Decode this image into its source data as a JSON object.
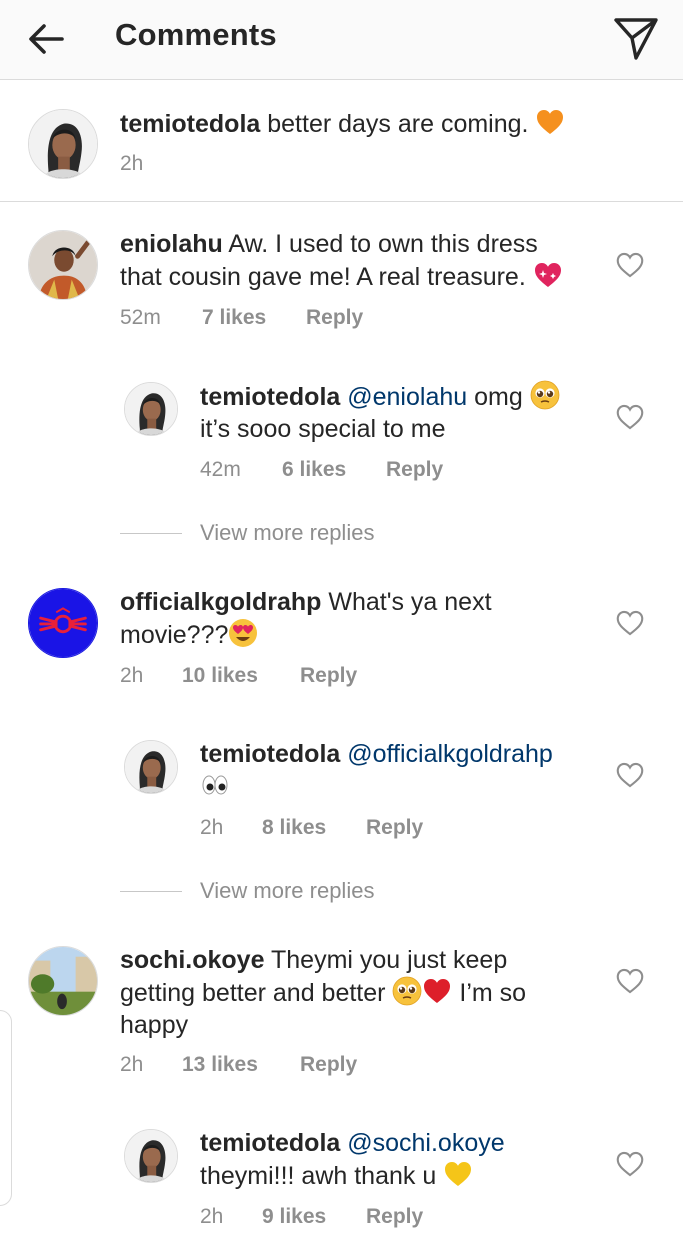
{
  "header": {
    "title": "Comments",
    "back_icon": "arrow-left-icon",
    "send_icon": "paper-plane-icon"
  },
  "caption": {
    "username": "temiotedola",
    "text": "better days are coming.",
    "emoji": "orange-heart",
    "time": "2h"
  },
  "comments": [
    {
      "username": "eniolahu",
      "text_line1": "Aw. I used to own this dress",
      "text_line2": "that cousin gave me! A real treasure.",
      "emoji": "sparkling-heart",
      "time": "52m",
      "likes": "7 likes",
      "reply": "Reply",
      "replies": [
        {
          "username": "temiotedola",
          "mention": "@eniolahu",
          "text_line1": "omg",
          "emoji": "pleading-face",
          "text_line2": "it’s sooo special to me",
          "time": "42m",
          "likes": "6 likes",
          "reply": "Reply"
        }
      ],
      "view_more": "View more replies"
    },
    {
      "username": "officialkgoldrahp",
      "text_line1": "What's ya next",
      "text_line2": "movie???",
      "emoji": "heart-eyes",
      "time": "2h",
      "likes": "10 likes",
      "reply": "Reply",
      "replies": [
        {
          "username": "temiotedola",
          "mention": "@officialkgoldrahp",
          "emoji": "eyes",
          "time": "2h",
          "likes": "8 likes",
          "reply": "Reply"
        }
      ],
      "view_more": "View more replies"
    },
    {
      "username": "sochi.okoye",
      "text_line1": "Theymi you just keep",
      "text_line2a": "getting better and better",
      "text_line2b": "I’m so",
      "text_line3": "happy",
      "emojis": [
        "pleading-face",
        "red-heart"
      ],
      "time": "2h",
      "likes": "13 likes",
      "reply": "Reply",
      "replies": [
        {
          "username": "temiotedola",
          "mention": "@sochi.okoye",
          "text_line2": "theymi!!! awh thank u",
          "emoji": "yellow-heart",
          "time": "2h",
          "likes": "9 likes",
          "reply": "Reply"
        }
      ]
    }
  ],
  "icons": {
    "like": "heart-outline-icon"
  },
  "colors": {
    "mention": "#00376b",
    "meta": "#8e8e8e",
    "text": "#262626"
  }
}
